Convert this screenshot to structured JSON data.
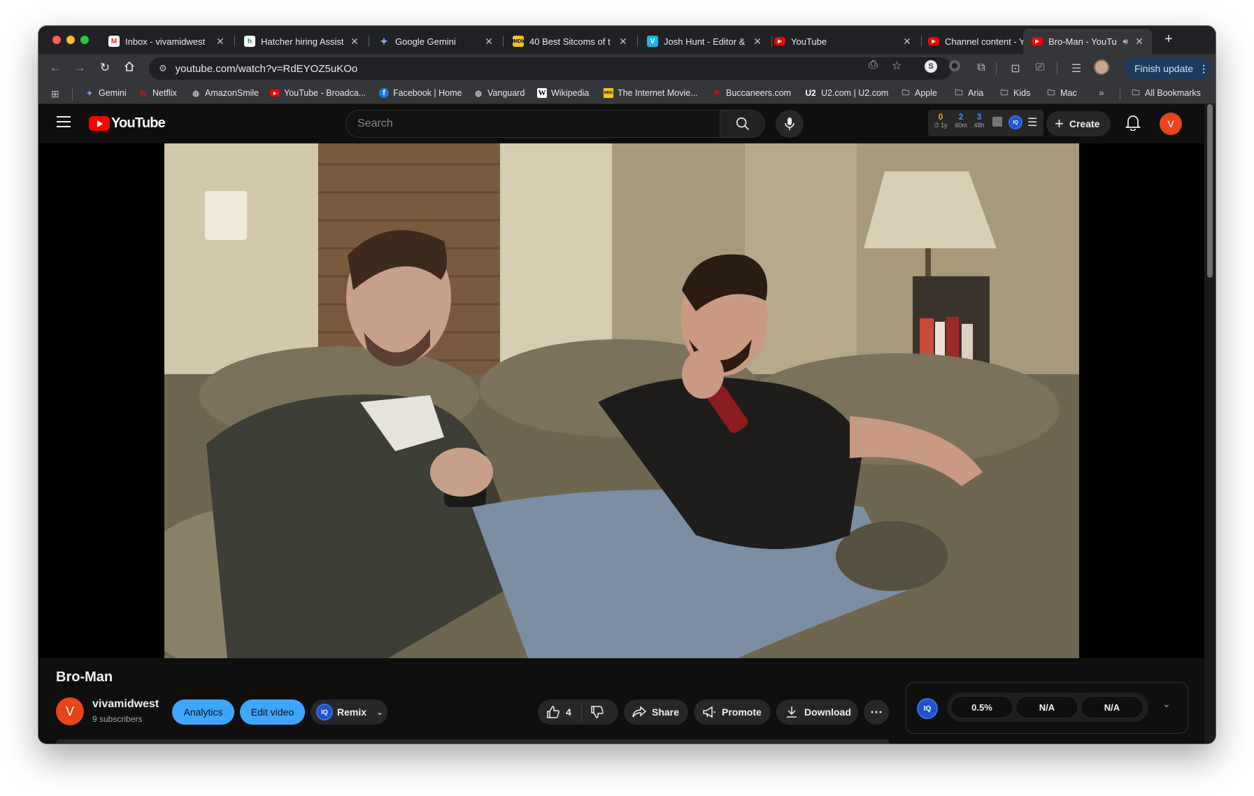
{
  "browser": {
    "tabs": [
      {
        "title": "Inbox - vivamidwest",
        "favicon": "gmail-icon"
      },
      {
        "title": "Hatcher hiring Assist",
        "favicon": "hatcher-icon"
      },
      {
        "title": "Google Gemini",
        "favicon": "gemini-icon"
      },
      {
        "title": "40 Best Sitcoms of t",
        "favicon": "imdb-icon"
      },
      {
        "title": "Josh Hunt - Editor &",
        "favicon": "vimeo-icon"
      },
      {
        "title": "YouTube",
        "favicon": "youtube-icon"
      },
      {
        "title": "Channel content - Yo",
        "favicon": "youtube-studio-icon"
      },
      {
        "title": "Bro-Man - YouTu",
        "favicon": "youtube-icon",
        "active": true
      }
    ],
    "url": "youtube.com/watch?v=RdEYOZ5uKOo",
    "finish_update": "Finish update",
    "bookmarks": [
      {
        "label": "Gemini"
      },
      {
        "label": "Netflix"
      },
      {
        "label": "AmazonSmile"
      },
      {
        "label": "YouTube - Broadca..."
      },
      {
        "label": "Facebook | Home"
      },
      {
        "label": "Vanguard"
      },
      {
        "label": "Wikipedia"
      },
      {
        "label": "The Internet Movie..."
      },
      {
        "label": "Buccaneers.com"
      },
      {
        "label": "U2.com | U2.com"
      },
      {
        "label": "Apple"
      },
      {
        "label": "Aria"
      },
      {
        "label": "Kids"
      },
      {
        "label": "Mac"
      }
    ],
    "all_bookmarks": "All Bookmarks",
    "more_bookmarks": "»"
  },
  "youtube": {
    "logo_text": "YouTube",
    "search_placeholder": "Search",
    "ext_stats": [
      {
        "value": "0",
        "label": "1y",
        "color": "#f5a623"
      },
      {
        "value": "2",
        "label": "60m",
        "color": "#4a8cff"
      },
      {
        "value": "3",
        "label": "48h",
        "color": "#4a8cff"
      }
    ],
    "create_label": "Create",
    "avatar_letter": "V",
    "video": {
      "title": "Bro-Man",
      "channel_name": "vivamidwest",
      "channel_avatar_letter": "V",
      "subscribers": "9 subscribers",
      "analytics_label": "Analytics",
      "edit_label": "Edit video",
      "remix_label": "Remix",
      "remix_badge": "IQ",
      "like_count": "4",
      "share_label": "Share",
      "promote_label": "Promote",
      "download_label": "Download"
    },
    "vidiq_panel": {
      "badge": "IQ",
      "metrics": [
        "0.5%",
        "N/A",
        "N/A"
      ]
    }
  },
  "colors": {
    "accent_blue": "#3ea6ff",
    "youtube_red": "#ff0000",
    "avatar_orange": "#e8451c"
  }
}
